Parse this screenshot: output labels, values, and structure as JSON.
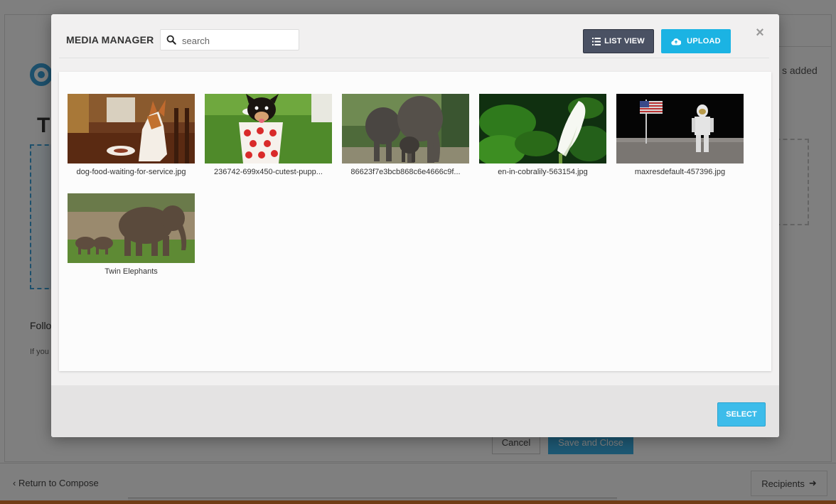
{
  "background": {
    "added_text": "s added",
    "big_letter": "T",
    "follow_text": "Follo",
    "ifyou_text": "If you",
    "cancel_label": "Cancel",
    "save_close_label": "Save and Close",
    "return_label": "Return to Compose",
    "recipients_label": "Recipients"
  },
  "modal": {
    "title": "MEDIA MANAGER",
    "search": {
      "placeholder": "search",
      "value": ""
    },
    "list_view_label": "LIST VIEW",
    "upload_label": "UPLOAD",
    "close_symbol": "×",
    "select_label": "SELECT",
    "media": [
      {
        "caption": "dog-food-waiting-for-service.jpg",
        "icon": "dog-photo-thumbnail"
      },
      {
        "caption": "236742-699x450-cutest-pupp...",
        "icon": "puppy-in-cup-thumbnail"
      },
      {
        "caption": "86623f7e3bcb868c6e4666c9f...",
        "icon": "elephant-family-thumbnail"
      },
      {
        "caption": "en-in-cobralily-563154.jpg",
        "icon": "cobra-lily-thumbnail"
      },
      {
        "caption": "maxresdefault-457396.jpg",
        "icon": "moon-landing-thumbnail"
      },
      {
        "caption": "Twin Elephants",
        "icon": "twin-elephants-thumbnail"
      }
    ]
  },
  "colors": {
    "primary_dark": "#4a5163",
    "accent_blue": "#1bb3e3",
    "select_blue": "#3dbcea"
  }
}
